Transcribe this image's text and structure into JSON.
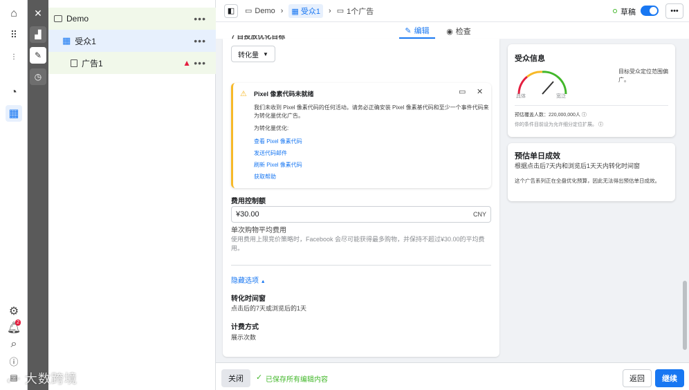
{
  "tree": {
    "items": [
      {
        "label": "Demo"
      },
      {
        "label": "受众1"
      },
      {
        "label": "广告1"
      }
    ]
  },
  "topbar": {
    "crumbs": [
      "Demo",
      "受众1",
      "1个广告"
    ],
    "status": "草稿"
  },
  "tabs": {
    "edit": "编辑",
    "review": "检查"
  },
  "form": {
    "cut_heading": "7 目投放优化目标",
    "optimization_value": "转化量",
    "pixel_notice": {
      "title": "Pixel 像素代码未就绪",
      "body": "我们未收到 Pixel 像素代码的任何活动。请务必正确安装 Pixel 像素基代码和至少一个事件代码来为转化量优化广告。",
      "sub": "为转化量优化:",
      "links": [
        "查看 Pixel 像素代码",
        "发送代码邮件",
        "刷新 Pixel 像素代码",
        "获取帮助"
      ]
    },
    "cost_cap_label": "费用控制额",
    "cost_cap_value": "¥30.00",
    "currency": "CNY",
    "cost_desc_title": "单次购物平均费用",
    "cost_desc": "使用费用上限竞价策略时，Facebook 会尽可能获得最多购物，并保持不超过¥30.00的平均费用。",
    "hide_options": "隐藏选项",
    "window_label": "转化时间窗",
    "window_value": "点击后的7天或浏览后的1天",
    "billing_label": "计费方式",
    "billing_value": "展示次数"
  },
  "audience": {
    "title": "受众信息",
    "gauge_left": "具体",
    "gauge_right": "宽泛",
    "side_text": "目标受众定位范围偏广。",
    "reach": "预估覆盖人数：220,000,000人",
    "reach_note": "你的条件目前设为允许细分定位扩展。"
  },
  "estimate": {
    "title": "预估单日成效",
    "subtitle": "根据点击后7天内和浏览后1天天内转化时间窗",
    "note": "这个广告系列正在全盘优化预算，因此无法得出预估单日成效。"
  },
  "footer": {
    "close": "关闭",
    "saved": "已保存所有编辑内容",
    "back": "返回",
    "continue": "继续"
  },
  "notifications": {
    "count": "2"
  },
  "watermark": "大数跨境"
}
